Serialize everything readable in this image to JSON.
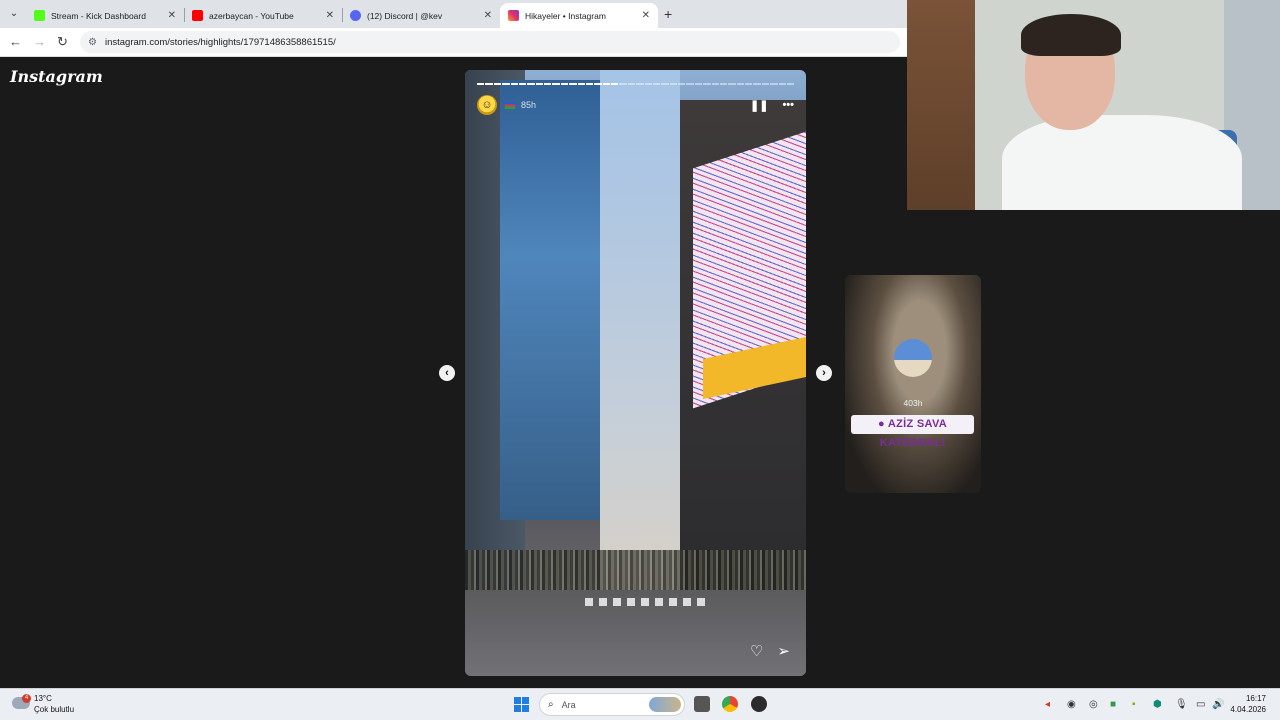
{
  "browser": {
    "tabs": [
      {
        "title": "Stream - Kick Dashboard",
        "favicon_color": "#53fc18",
        "active": false
      },
      {
        "title": "azerbaycan - YouTube",
        "favicon_color": "#ff0000",
        "active": false
      },
      {
        "title": "(12) Discord | @kev",
        "favicon_color": "#5865f2",
        "active": false
      },
      {
        "title": "Hikayeler • Instagram",
        "favicon_color": "#e1306c",
        "active": true
      }
    ],
    "url": "instagram.com/stories/highlights/17971486358861515/"
  },
  "instagram": {
    "logo": "Instagram",
    "story": {
      "time": "85h",
      "progress_total": 38,
      "progress_done": 17
    },
    "next_story": {
      "time": "403h",
      "location": "AZİZ SAVA KATEDRALİ"
    }
  },
  "taskbar": {
    "weather": {
      "badge": "4",
      "temp": "13°C",
      "desc": "Çok bulutlu"
    },
    "search_placeholder": "Ara",
    "clock": {
      "time": "16:17",
      "date": "4.04.2026"
    }
  }
}
